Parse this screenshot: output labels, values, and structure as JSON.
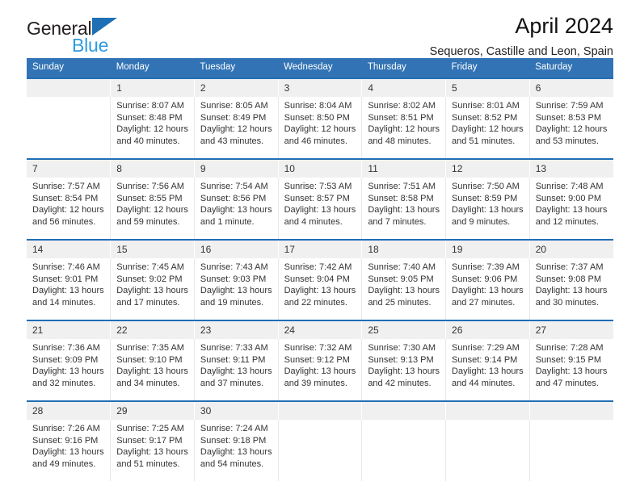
{
  "logo": {
    "word_top": "General",
    "word_bottom": "Blue",
    "triangle_icon": "logo-triangle-icon",
    "accent_dark": "#1f6fb5",
    "accent_light": "#2e9ae0"
  },
  "header": {
    "title": "April 2024",
    "subtitle": "Sequeros, Castille and Leon, Spain"
  },
  "theme": {
    "header_blue": "#3273b5",
    "rule_blue": "#1f6fb5",
    "date_band_gray": "#f0f0f0"
  },
  "weekdays": [
    "Sunday",
    "Monday",
    "Tuesday",
    "Wednesday",
    "Thursday",
    "Friday",
    "Saturday"
  ],
  "labels": {
    "sunrise": "Sunrise:",
    "sunset": "Sunset:",
    "daylight": "Daylight:"
  },
  "weeks": [
    [
      {
        "day": "",
        "sunrise": "",
        "sunset": "",
        "daylight_1": "",
        "daylight_2": ""
      },
      {
        "day": "1",
        "sunrise": "Sunrise: 8:07 AM",
        "sunset": "Sunset: 8:48 PM",
        "daylight_1": "Daylight: 12 hours",
        "daylight_2": "and 40 minutes."
      },
      {
        "day": "2",
        "sunrise": "Sunrise: 8:05 AM",
        "sunset": "Sunset: 8:49 PM",
        "daylight_1": "Daylight: 12 hours",
        "daylight_2": "and 43 minutes."
      },
      {
        "day": "3",
        "sunrise": "Sunrise: 8:04 AM",
        "sunset": "Sunset: 8:50 PM",
        "daylight_1": "Daylight: 12 hours",
        "daylight_2": "and 46 minutes."
      },
      {
        "day": "4",
        "sunrise": "Sunrise: 8:02 AM",
        "sunset": "Sunset: 8:51 PM",
        "daylight_1": "Daylight: 12 hours",
        "daylight_2": "and 48 minutes."
      },
      {
        "day": "5",
        "sunrise": "Sunrise: 8:01 AM",
        "sunset": "Sunset: 8:52 PM",
        "daylight_1": "Daylight: 12 hours",
        "daylight_2": "and 51 minutes."
      },
      {
        "day": "6",
        "sunrise": "Sunrise: 7:59 AM",
        "sunset": "Sunset: 8:53 PM",
        "daylight_1": "Daylight: 12 hours",
        "daylight_2": "and 53 minutes."
      }
    ],
    [
      {
        "day": "7",
        "sunrise": "Sunrise: 7:57 AM",
        "sunset": "Sunset: 8:54 PM",
        "daylight_1": "Daylight: 12 hours",
        "daylight_2": "and 56 minutes."
      },
      {
        "day": "8",
        "sunrise": "Sunrise: 7:56 AM",
        "sunset": "Sunset: 8:55 PM",
        "daylight_1": "Daylight: 12 hours",
        "daylight_2": "and 59 minutes."
      },
      {
        "day": "9",
        "sunrise": "Sunrise: 7:54 AM",
        "sunset": "Sunset: 8:56 PM",
        "daylight_1": "Daylight: 13 hours",
        "daylight_2": "and 1 minute."
      },
      {
        "day": "10",
        "sunrise": "Sunrise: 7:53 AM",
        "sunset": "Sunset: 8:57 PM",
        "daylight_1": "Daylight: 13 hours",
        "daylight_2": "and 4 minutes."
      },
      {
        "day": "11",
        "sunrise": "Sunrise: 7:51 AM",
        "sunset": "Sunset: 8:58 PM",
        "daylight_1": "Daylight: 13 hours",
        "daylight_2": "and 7 minutes."
      },
      {
        "day": "12",
        "sunrise": "Sunrise: 7:50 AM",
        "sunset": "Sunset: 8:59 PM",
        "daylight_1": "Daylight: 13 hours",
        "daylight_2": "and 9 minutes."
      },
      {
        "day": "13",
        "sunrise": "Sunrise: 7:48 AM",
        "sunset": "Sunset: 9:00 PM",
        "daylight_1": "Daylight: 13 hours",
        "daylight_2": "and 12 minutes."
      }
    ],
    [
      {
        "day": "14",
        "sunrise": "Sunrise: 7:46 AM",
        "sunset": "Sunset: 9:01 PM",
        "daylight_1": "Daylight: 13 hours",
        "daylight_2": "and 14 minutes."
      },
      {
        "day": "15",
        "sunrise": "Sunrise: 7:45 AM",
        "sunset": "Sunset: 9:02 PM",
        "daylight_1": "Daylight: 13 hours",
        "daylight_2": "and 17 minutes."
      },
      {
        "day": "16",
        "sunrise": "Sunrise: 7:43 AM",
        "sunset": "Sunset: 9:03 PM",
        "daylight_1": "Daylight: 13 hours",
        "daylight_2": "and 19 minutes."
      },
      {
        "day": "17",
        "sunrise": "Sunrise: 7:42 AM",
        "sunset": "Sunset: 9:04 PM",
        "daylight_1": "Daylight: 13 hours",
        "daylight_2": "and 22 minutes."
      },
      {
        "day": "18",
        "sunrise": "Sunrise: 7:40 AM",
        "sunset": "Sunset: 9:05 PM",
        "daylight_1": "Daylight: 13 hours",
        "daylight_2": "and 25 minutes."
      },
      {
        "day": "19",
        "sunrise": "Sunrise: 7:39 AM",
        "sunset": "Sunset: 9:06 PM",
        "daylight_1": "Daylight: 13 hours",
        "daylight_2": "and 27 minutes."
      },
      {
        "day": "20",
        "sunrise": "Sunrise: 7:37 AM",
        "sunset": "Sunset: 9:08 PM",
        "daylight_1": "Daylight: 13 hours",
        "daylight_2": "and 30 minutes."
      }
    ],
    [
      {
        "day": "21",
        "sunrise": "Sunrise: 7:36 AM",
        "sunset": "Sunset: 9:09 PM",
        "daylight_1": "Daylight: 13 hours",
        "daylight_2": "and 32 minutes."
      },
      {
        "day": "22",
        "sunrise": "Sunrise: 7:35 AM",
        "sunset": "Sunset: 9:10 PM",
        "daylight_1": "Daylight: 13 hours",
        "daylight_2": "and 34 minutes."
      },
      {
        "day": "23",
        "sunrise": "Sunrise: 7:33 AM",
        "sunset": "Sunset: 9:11 PM",
        "daylight_1": "Daylight: 13 hours",
        "daylight_2": "and 37 minutes."
      },
      {
        "day": "24",
        "sunrise": "Sunrise: 7:32 AM",
        "sunset": "Sunset: 9:12 PM",
        "daylight_1": "Daylight: 13 hours",
        "daylight_2": "and 39 minutes."
      },
      {
        "day": "25",
        "sunrise": "Sunrise: 7:30 AM",
        "sunset": "Sunset: 9:13 PM",
        "daylight_1": "Daylight: 13 hours",
        "daylight_2": "and 42 minutes."
      },
      {
        "day": "26",
        "sunrise": "Sunrise: 7:29 AM",
        "sunset": "Sunset: 9:14 PM",
        "daylight_1": "Daylight: 13 hours",
        "daylight_2": "and 44 minutes."
      },
      {
        "day": "27",
        "sunrise": "Sunrise: 7:28 AM",
        "sunset": "Sunset: 9:15 PM",
        "daylight_1": "Daylight: 13 hours",
        "daylight_2": "and 47 minutes."
      }
    ],
    [
      {
        "day": "28",
        "sunrise": "Sunrise: 7:26 AM",
        "sunset": "Sunset: 9:16 PM",
        "daylight_1": "Daylight: 13 hours",
        "daylight_2": "and 49 minutes."
      },
      {
        "day": "29",
        "sunrise": "Sunrise: 7:25 AM",
        "sunset": "Sunset: 9:17 PM",
        "daylight_1": "Daylight: 13 hours",
        "daylight_2": "and 51 minutes."
      },
      {
        "day": "30",
        "sunrise": "Sunrise: 7:24 AM",
        "sunset": "Sunset: 9:18 PM",
        "daylight_1": "Daylight: 13 hours",
        "daylight_2": "and 54 minutes."
      },
      {
        "day": "",
        "sunrise": "",
        "sunset": "",
        "daylight_1": "",
        "daylight_2": ""
      },
      {
        "day": "",
        "sunrise": "",
        "sunset": "",
        "daylight_1": "",
        "daylight_2": ""
      },
      {
        "day": "",
        "sunrise": "",
        "sunset": "",
        "daylight_1": "",
        "daylight_2": ""
      },
      {
        "day": "",
        "sunrise": "",
        "sunset": "",
        "daylight_1": "",
        "daylight_2": ""
      }
    ]
  ]
}
